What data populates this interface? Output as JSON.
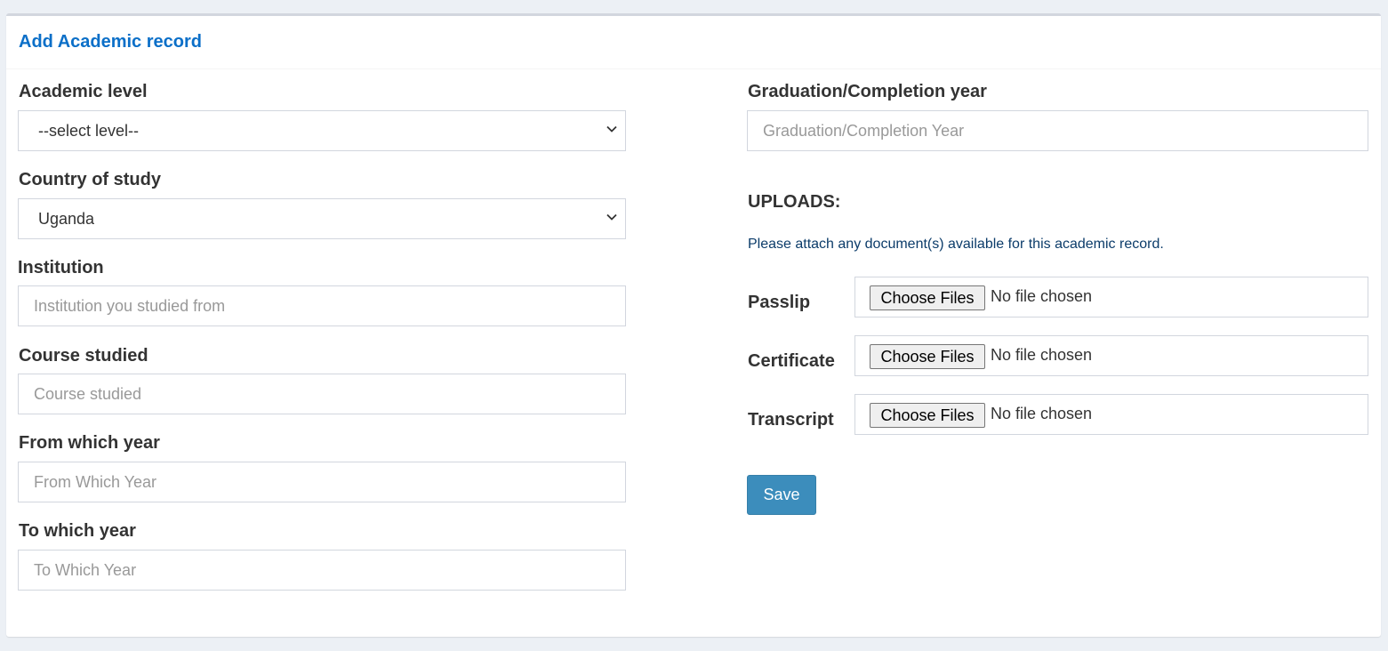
{
  "card": {
    "title": "Add Academic record"
  },
  "left": {
    "academic_level": {
      "label": "Academic level",
      "value": "--select level--"
    },
    "country": {
      "label": "Country of study",
      "value": "Uganda"
    },
    "institution": {
      "label": "Institution",
      "placeholder": "Institution you studied from"
    },
    "course": {
      "label": "Course studied",
      "placeholder": "Course studied"
    },
    "from_year": {
      "label": "From which year",
      "placeholder": "From Which Year"
    },
    "to_year": {
      "label": "To which year",
      "placeholder": "To Which Year"
    }
  },
  "right": {
    "graduation": {
      "label": "Graduation/Completion year",
      "placeholder": "Graduation/Completion Year"
    },
    "uploads_title": "UPLOADS:",
    "uploads_help": "Please attach any document(s) available for this academic record.",
    "files": [
      {
        "label": "Passlip",
        "button": "Choose Files",
        "status": "No file chosen"
      },
      {
        "label": "Certificate",
        "button": "Choose Files",
        "status": "No file chosen"
      },
      {
        "label": "Transcript",
        "button": "Choose Files",
        "status": "No file chosen"
      }
    ],
    "save_label": "Save"
  },
  "colors": {
    "title": "#0b6fc8",
    "primary_button": "#3c8dbc",
    "background": "#ecf0f5"
  },
  "icons": {
    "select_arrow": "chevron-down-icon"
  }
}
